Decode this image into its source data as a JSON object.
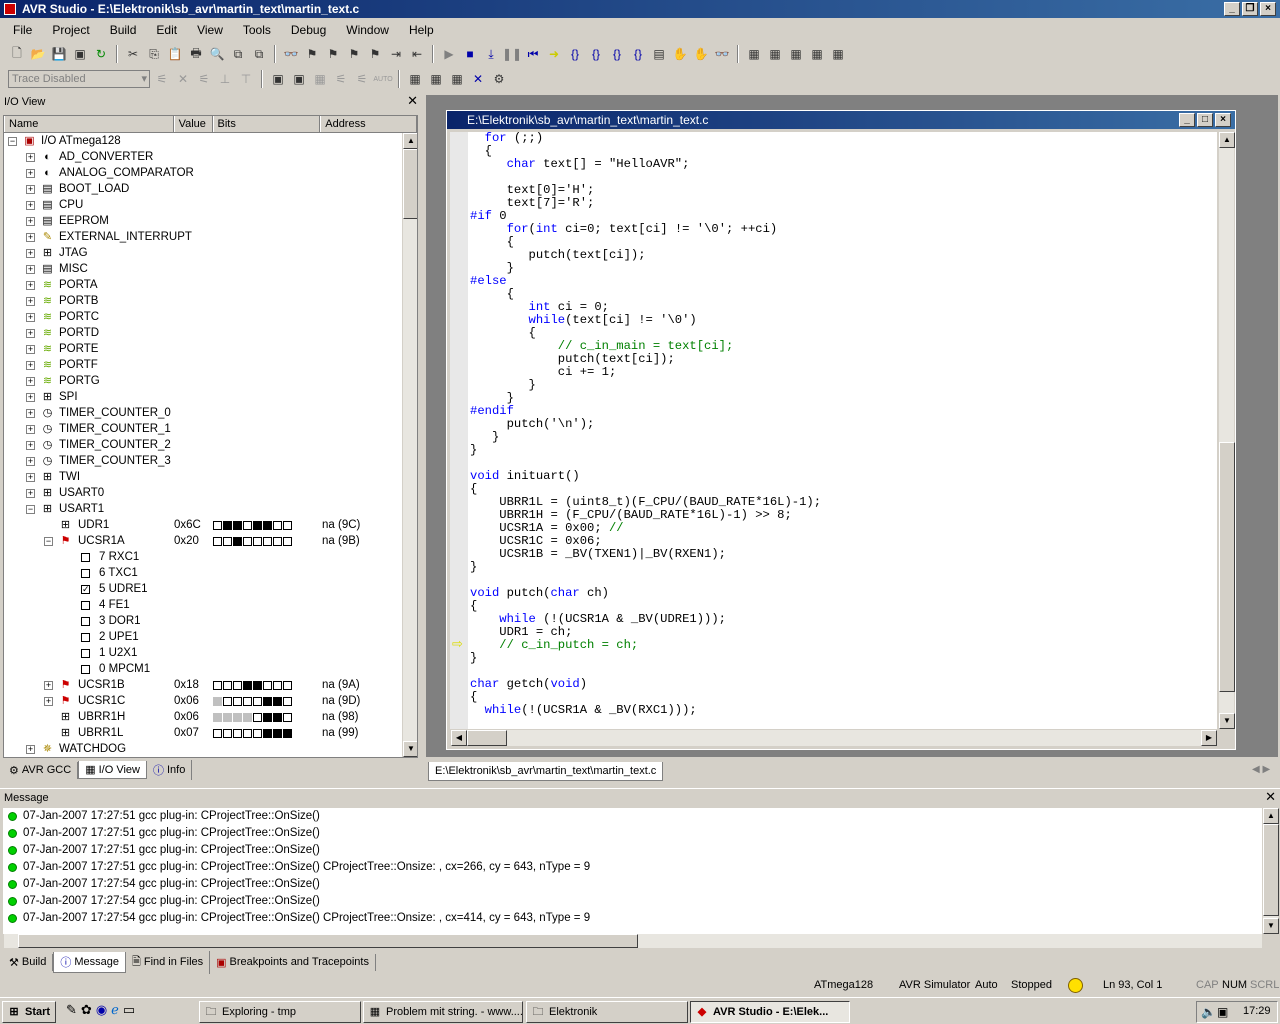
{
  "app": {
    "title": "AVR Studio - E:\\Elektronik\\sb_avr\\martin_text\\martin_text.c"
  },
  "menu": [
    "File",
    "Project",
    "Build",
    "Edit",
    "View",
    "Tools",
    "Debug",
    "Window",
    "Help"
  ],
  "trace_combo": "Trace Disabled",
  "io_view": {
    "title": "I/O View",
    "columns": [
      "Name",
      "Value",
      "Bits",
      "Address"
    ],
    "root": "I/O ATmega128",
    "modules": [
      "AD_CONVERTER",
      "ANALOG_COMPARATOR",
      "BOOT_LOAD",
      "CPU",
      "EEPROM",
      "EXTERNAL_INTERRUPT",
      "JTAG",
      "MISC",
      "PORTA",
      "PORTB",
      "PORTC",
      "PORTD",
      "PORTE",
      "PORTF",
      "PORTG",
      "SPI",
      "TIMER_COUNTER_0",
      "TIMER_COUNTER_1",
      "TIMER_COUNTER_2",
      "TIMER_COUNTER_3",
      "TWI",
      "USART0",
      "USART1"
    ],
    "usart1_regs": [
      {
        "name": "UDR1",
        "value": "0x6C",
        "bits": [
          0,
          1,
          1,
          0,
          1,
          1,
          0,
          0
        ],
        "addr": "na (9C)"
      },
      {
        "name": "UCSR1A",
        "value": "0x20",
        "bits": [
          0,
          0,
          1,
          0,
          0,
          0,
          0,
          0
        ],
        "addr": "na (9B)"
      }
    ],
    "ucsr1a_bits": [
      {
        "label": "7 RXC1",
        "checked": false
      },
      {
        "label": "6 TXC1",
        "checked": false
      },
      {
        "label": "5 UDRE1",
        "checked": true
      },
      {
        "label": "4 FE1",
        "checked": false
      },
      {
        "label": "3 DOR1",
        "checked": false
      },
      {
        "label": "2 UPE1",
        "checked": false
      },
      {
        "label": "1 U2X1",
        "checked": false
      },
      {
        "label": "0 MPCM1",
        "checked": false
      }
    ],
    "more_regs": [
      {
        "name": "UCSR1B",
        "value": "0x18",
        "bits": [
          0,
          0,
          0,
          1,
          1,
          0,
          0,
          0
        ],
        "addr": "na (9A)"
      },
      {
        "name": "UCSR1C",
        "value": "0x06",
        "bits": [
          "g",
          0,
          0,
          0,
          0,
          1,
          1,
          0
        ],
        "addr": "na (9D)"
      },
      {
        "name": "UBRR1H",
        "value": "0x06",
        "bits": [
          "g",
          "g",
          "g",
          "g",
          0,
          1,
          1,
          0
        ],
        "addr": "na (98)"
      },
      {
        "name": "UBRR1L",
        "value": "0x07",
        "bits": [
          0,
          0,
          0,
          0,
          0,
          1,
          1,
          1
        ],
        "addr": "na (99)"
      }
    ],
    "last": "WATCHDOG"
  },
  "left_tabs": [
    "AVR GCC",
    "I/O View",
    "Info"
  ],
  "editor": {
    "title": "E:\\Elektronik\\sb_avr\\martin_text\\martin_text.c",
    "tab": "E:\\Elektronik\\sb_avr\\martin_text\\martin_text.c"
  },
  "messages": {
    "title": "Message",
    "rows": [
      "07-Jan-2007 17:27:51   gcc plug-in: CProjectTree::OnSize()",
      "07-Jan-2007 17:27:51   gcc plug-in: CProjectTree::OnSize()",
      "07-Jan-2007 17:27:51   gcc plug-in: CProjectTree::OnSize()",
      "07-Jan-2007 17:27:51   gcc plug-in: CProjectTree::OnSize() CProjectTree::Onsize: , cx=266, cy = 643, nType = 9",
      "07-Jan-2007 17:27:54   gcc plug-in: CProjectTree::OnSize()",
      "07-Jan-2007 17:27:54   gcc plug-in: CProjectTree::OnSize()",
      "07-Jan-2007 17:27:54   gcc plug-in: CProjectTree::OnSize() CProjectTree::Onsize: , cx=414, cy = 643, nType = 9"
    ]
  },
  "bottom_tabs": [
    "Build",
    "Message",
    "Find in Files",
    "Breakpoints and Tracepoints"
  ],
  "status": {
    "device": "ATmega128",
    "platform": "AVR Simulator",
    "mode": "Auto",
    "state": "Stopped",
    "position": "Ln 93, Col 1",
    "cap": "CAP",
    "num": "NUM",
    "scrl": "SCRL"
  },
  "taskbar": {
    "start": "Start",
    "buttons": [
      "Exploring - tmp",
      "Problem mit string. - www....",
      "Elektronik",
      "AVR Studio - E:\\Elek..."
    ],
    "clock": "17:29"
  }
}
